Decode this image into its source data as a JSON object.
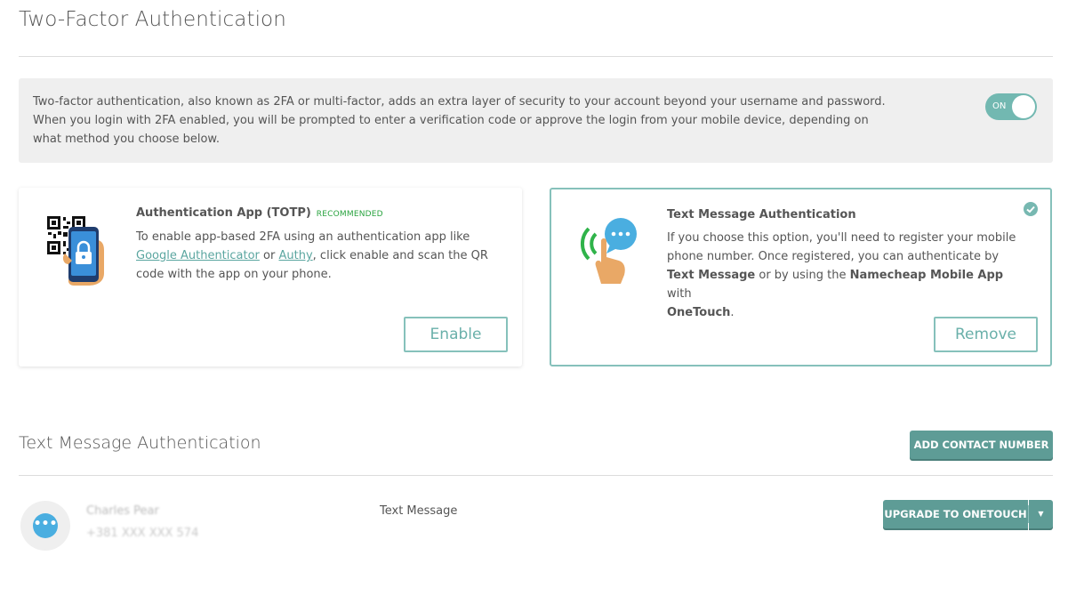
{
  "page": {
    "title": "Two-Factor Authentication"
  },
  "intro": {
    "text": "Two-factor authentication, also known as 2FA or multi-factor, adds an extra layer of security to your account beyond your username and password. When you login with 2FA enabled, you will be prompted to enter a verification code or approve the login from your mobile device, depending on what method you choose below.",
    "toggle_label": "ON",
    "toggle_state": "on"
  },
  "methods": {
    "totp": {
      "title": "Authentication App (TOTP)",
      "badge": "RECOMMENDED",
      "desc_before": "To enable app-based 2FA using an authentication app like",
      "link1": "Google Authenticator",
      "or": "or",
      "link2": "Authy",
      "desc_after": ", click enable and scan the QR code with the app on your phone.",
      "button": "Enable",
      "icon": "phone-lock-icon"
    },
    "sms": {
      "title": "Text Message Authentication",
      "desc_1": "If you choose this option, you'll need to register your mobile phone number. Once registered, you can authenticate by",
      "bold_1": "Text Message",
      "desc_2": "or by using the",
      "bold_2": "Namecheap Mobile App",
      "desc_3": "with",
      "bold_3": "OneTouch",
      "desc_4": ".",
      "button": "Remove",
      "selected": true,
      "icon": "tap-message-icon"
    }
  },
  "sms_section": {
    "title": "Text Message Authentication",
    "add_button": "ADD CONTACT NUMBER",
    "contacts": [
      {
        "name": "Charles Pear",
        "phone": "+381 XXX XXX 574",
        "method": "Text Message",
        "action": "UPGRADE TO ONETOUCH"
      }
    ]
  },
  "colors": {
    "accent": "#72b8b1",
    "button_dark": "#5e9c96",
    "recommended": "#29a33f",
    "chat_blue": "#4aaee0"
  }
}
